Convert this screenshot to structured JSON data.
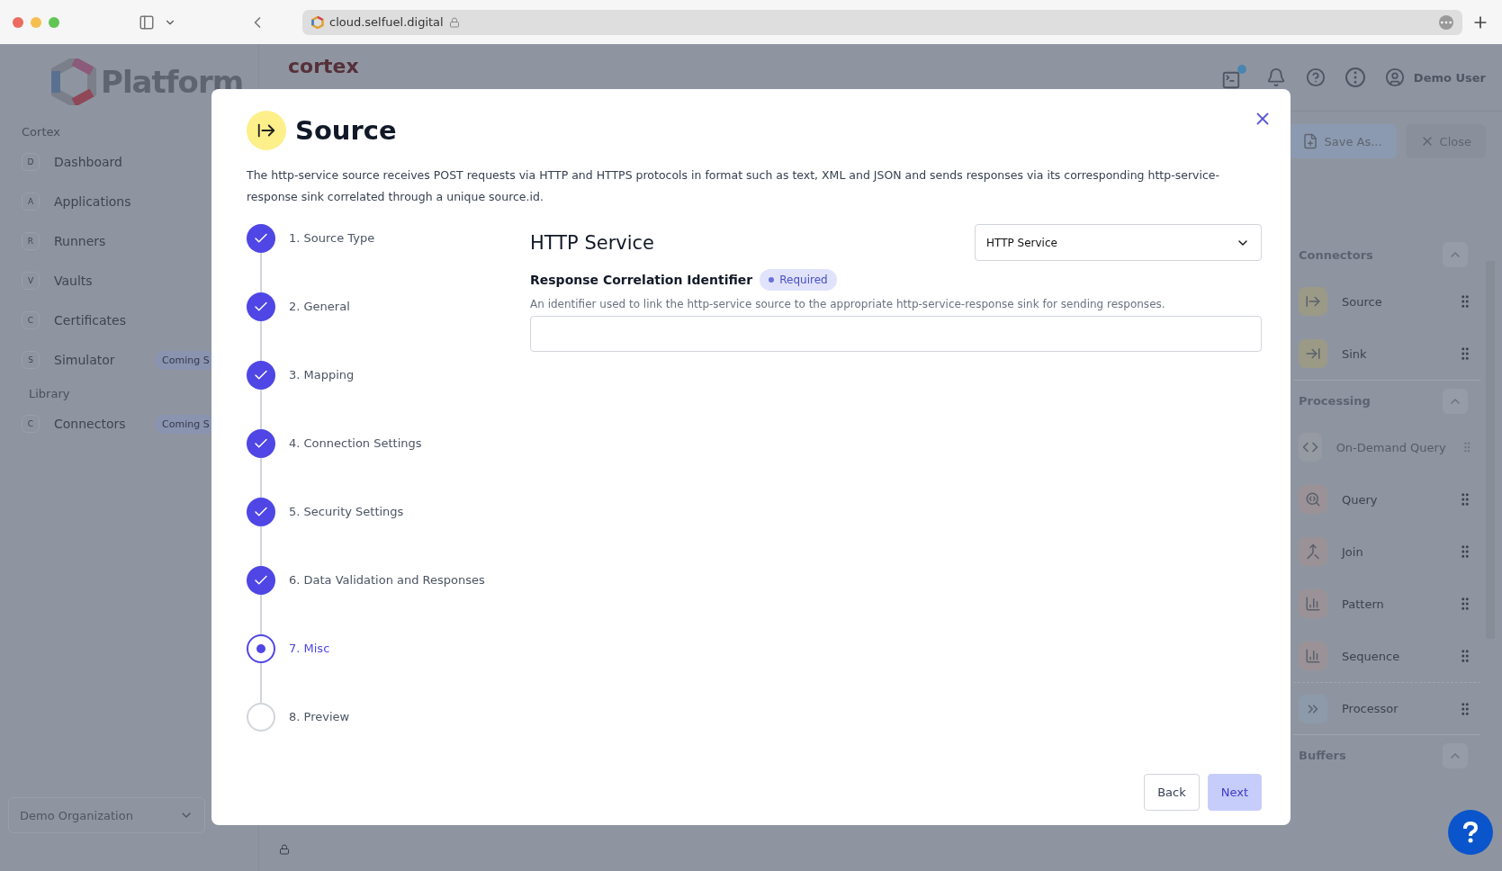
{
  "browser": {
    "url": "cloud.selfuel.digital"
  },
  "sidebar": {
    "logo": "Platform",
    "sections": [
      {
        "title": "Cortex",
        "items": [
          {
            "letter": "D",
            "label": "Dashboard"
          },
          {
            "letter": "A",
            "label": "Applications"
          },
          {
            "letter": "R",
            "label": "Runners"
          },
          {
            "letter": "V",
            "label": "Vaults"
          },
          {
            "letter": "C",
            "label": "Certificates"
          },
          {
            "letter": "S",
            "label": "Simulator",
            "badge": "Coming S"
          }
        ]
      },
      {
        "title": "Library",
        "items": [
          {
            "letter": "C",
            "label": "Connectors",
            "badge": "Coming S"
          }
        ]
      }
    ],
    "organization": "Demo Organization"
  },
  "header": {
    "app_logo": "cortex",
    "user": "Demo User",
    "notification_dot": true
  },
  "toolbar": {
    "buttons": [
      {
        "label": "Save As...",
        "kind": "save"
      },
      {
        "label": "Close",
        "kind": "close"
      }
    ]
  },
  "palette": {
    "sections": [
      {
        "title": "Connectors",
        "items": [
          {
            "label": "Source",
            "kind": "source",
            "disabled": false
          },
          {
            "label": "Sink",
            "kind": "sink",
            "disabled": false
          }
        ]
      },
      {
        "title": "Processing",
        "items": [
          {
            "label": "On-Demand Query",
            "kind": "code",
            "disabled": true
          },
          {
            "label": "Query",
            "kind": "query",
            "disabled": false
          },
          {
            "label": "Join",
            "kind": "join",
            "disabled": false
          },
          {
            "label": "Pattern",
            "kind": "pattern",
            "disabled": false
          },
          {
            "label": "Sequence",
            "kind": "pattern",
            "disabled": false
          },
          {
            "label": "Processor",
            "kind": "processor",
            "disabled": false
          }
        ]
      },
      {
        "title": "Buffers"
      }
    ]
  },
  "modal": {
    "title": "Source",
    "description": "The http-service source receives POST requests via HTTP and HTTPS protocols in format such as text, XML and JSON and sends responses via its corresponding http-service-response sink correlated through a unique source.id.",
    "steps": [
      {
        "label": "1. Source Type",
        "completed": true,
        "selected": false
      },
      {
        "label": "2. General",
        "completed": true,
        "selected": false
      },
      {
        "label": "3. Mapping",
        "completed": true,
        "selected": false
      },
      {
        "label": "4. Connection Settings",
        "completed": true,
        "selected": false
      },
      {
        "label": "5. Security Settings",
        "completed": true,
        "selected": false
      },
      {
        "label": "6. Data Validation and Responses",
        "completed": true,
        "selected": false
      },
      {
        "label": "7. Misc",
        "completed": false,
        "selected": true
      },
      {
        "label": "8. Preview",
        "completed": false,
        "selected": false
      }
    ],
    "heading": "HTTP Service",
    "type_select": {
      "value": "HTTP Service"
    },
    "field": {
      "label": "Response Correlation Identifier",
      "badge": "Required",
      "help": "An identifier used to link the http-service source to the appropriate http-service-response sink for sending responses."
    },
    "buttons": [
      {
        "label": "Back",
        "kind": "secondary"
      },
      {
        "label": "Next",
        "kind": "primary"
      }
    ]
  }
}
